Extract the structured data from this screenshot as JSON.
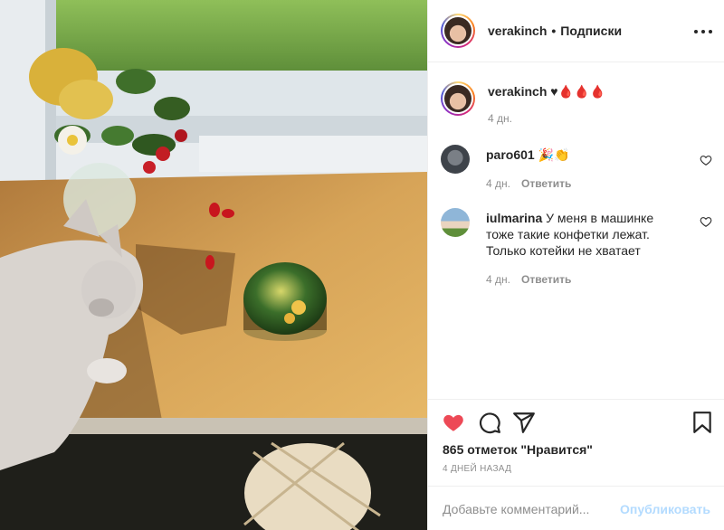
{
  "post": {
    "author": "verakinch",
    "follow_label": "Подписки",
    "dot": "•",
    "caption": "♥🩸🩸🩸",
    "caption_time": "4 дн."
  },
  "comments": [
    {
      "user": "paro601",
      "text": "🎉👏",
      "time": "4 дн.",
      "reply_label": "Ответить"
    },
    {
      "user": "iulmarina",
      "text": "У меня в машинке тоже такие конфетки лежат. Только котейки не хватает",
      "time": "4 дн.",
      "reply_label": "Ответить"
    }
  ],
  "stats": {
    "likes": "865 отметок \"Нравится\"",
    "time_ago": "4 дней назад"
  },
  "compose": {
    "placeholder": "Добавьте комментарий...",
    "publish_label": "Опубликовать"
  },
  "icons": {
    "like": "heart-icon",
    "comment": "comment-icon",
    "share": "share-icon",
    "save": "bookmark-icon",
    "more": "more-options-icon"
  },
  "colors": {
    "like_active": "#ed4956",
    "publish_disabled": "#b3dbff",
    "secondary_text": "#8e8e8e"
  }
}
